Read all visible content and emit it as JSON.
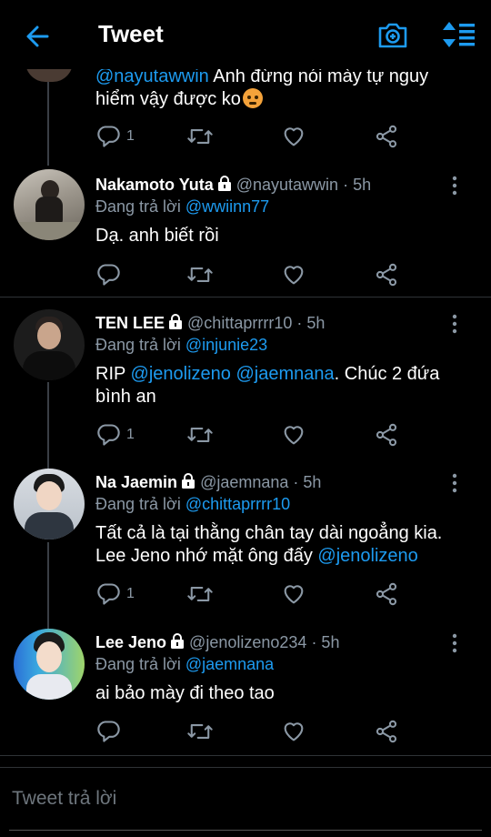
{
  "header": {
    "title": "Tweet",
    "accent": "#1d9bf0"
  },
  "top_partial": {
    "text_pre": "@nayutawwin",
    "text_rest": " Anh đừng nói mày tự nguy",
    "text_line2": "hiểm vậy được ko",
    "emoji": "angry-face",
    "reply_count": "1"
  },
  "tweets": [
    {
      "name": "Nakamoto Yuta",
      "handle": "@nayutawwin",
      "time": "· 5h",
      "replying_label": "Đang trả lời",
      "replying_to": "@wwiinn77",
      "text": "Dạ. anh biết rồi",
      "reply_count": ""
    },
    {
      "name": "TEN LEE",
      "handle": "@chittaprrrr10",
      "time": "· 5h",
      "replying_label": "Đang trả lời",
      "replying_to": "@injunie23",
      "text_pre": "RIP ",
      "mention1": "@jenolizeno",
      "mention2": "@jaemnana",
      "text_post": ". Chúc 2 đứa",
      "text_line2": "bình an",
      "reply_count": "1"
    },
    {
      "name": "Na Jaemin",
      "handle": "@jaemnana",
      "time": "· 5h",
      "replying_label": "Đang trả lời",
      "replying_to": "@chittaprrrr10",
      "text_line1": "Tất cả là tại thằng chân tay dài ngoẳng kia.",
      "text_line2_pre": "Lee Jeno nhớ mặt ông  đấy ",
      "text_line2_mention": "@jenolizeno",
      "reply_count": "1"
    },
    {
      "name": "Lee Jeno",
      "handle": "@jenolizeno234",
      "time": "· 5h",
      "replying_label": "Đang trả lời",
      "replying_to": "@jaemnana",
      "text": "ai bảo mày đi theo tao",
      "reply_count": ""
    }
  ],
  "reply_box": {
    "placeholder": "Tweet trả lời"
  }
}
